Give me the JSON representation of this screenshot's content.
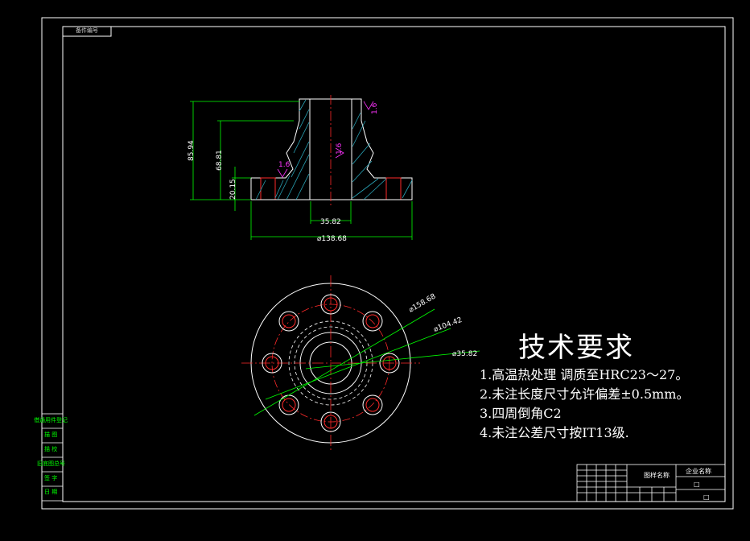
{
  "drawing": {
    "corner_tab": "备件编号",
    "colors": {
      "outline": "#ffffff",
      "dimension": "#00ff00",
      "hatch": "#2aa5b8",
      "center": "#ff2a2a",
      "roughness": "#ff33ff",
      "bolt": "#ff2a2a"
    },
    "dimensions": {
      "height_total": "85.94",
      "height_mid": "68.81",
      "height_flange": "20.15",
      "bore": "35.82",
      "flange_dia": "⌀138.68"
    },
    "roughness": [
      "1.6",
      "1.6",
      "1.6"
    ],
    "top_view_dims": [
      "⌀158.68",
      "⌀104.42",
      "⌀35.82"
    ]
  },
  "tech_requirements": {
    "title": "技术要求",
    "items": [
      "1.高温热处理 调质至HRC23～27。",
      "2.未注长度尺寸允许偏差±0.5mm。",
      "3.四周倒角C2",
      "4.未注公差尺寸按IT13级."
    ]
  },
  "side_table": {
    "rows": [
      "借通用件登记",
      "描 图",
      "描 校",
      "旧底图总号",
      "签 字",
      "日 期"
    ]
  },
  "title_block": {
    "drawing_label": "图样名称",
    "company": "企业名称",
    "box1": "□",
    "box2": "□"
  }
}
